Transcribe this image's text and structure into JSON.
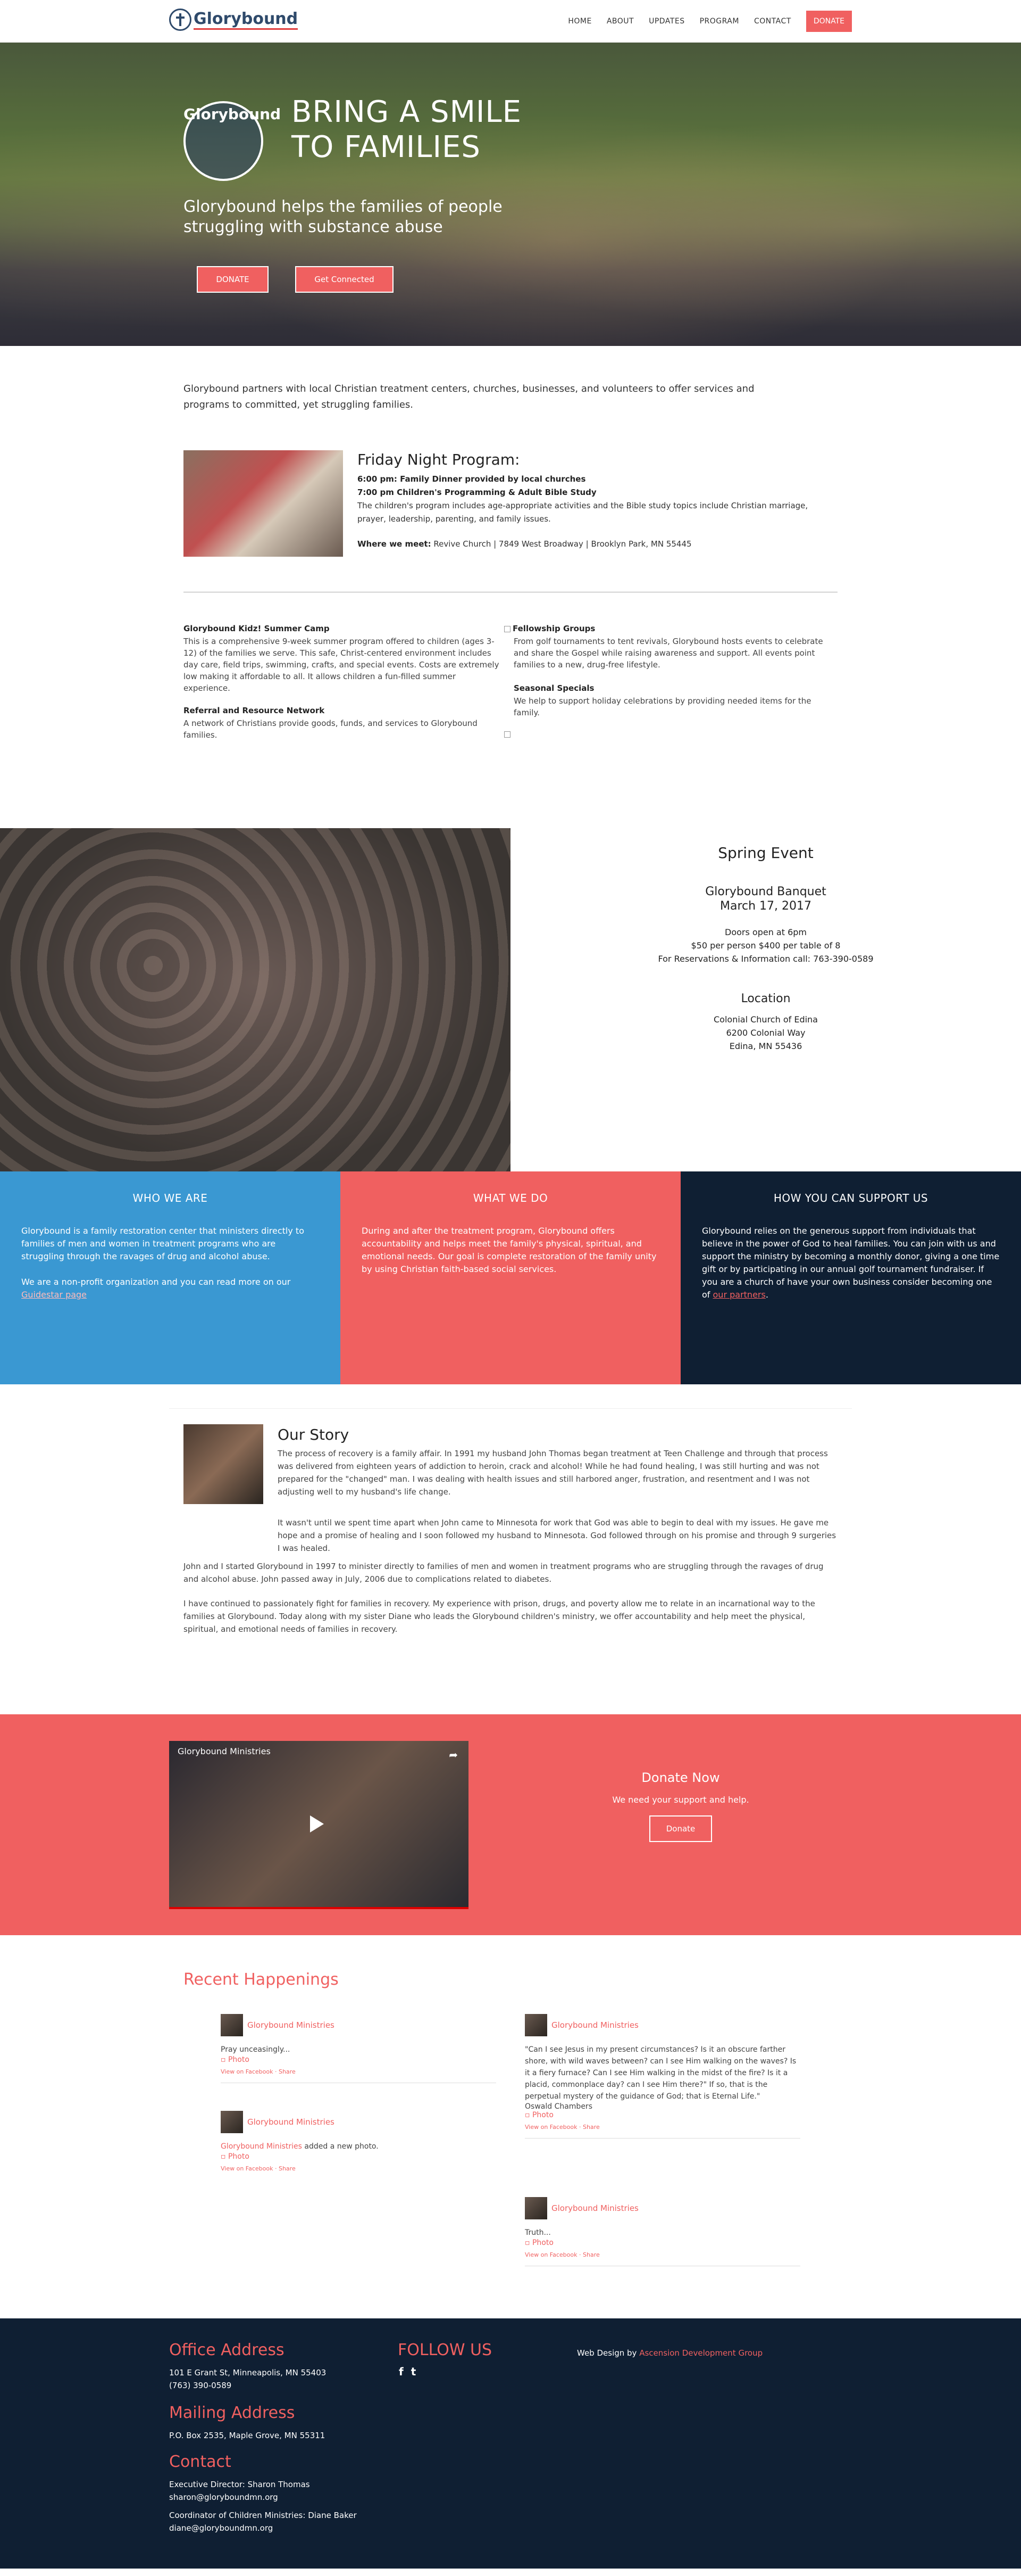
{
  "header": {
    "logo_text": "Glorybound",
    "nav": [
      "HOME",
      "ABOUT",
      "UPDATES",
      "PROGRAM",
      "CONTACT"
    ],
    "donate_label": "DONATE"
  },
  "hero": {
    "logo_text": "Glorybound",
    "title_line1": "BRING A SMILE",
    "title_line2": "TO FAMILIES",
    "subtitle": "Glorybound helps the families of people struggling with substance abuse",
    "donate_label": "DONATE",
    "connect_label": "Get Connected"
  },
  "intro": {
    "text": "Glorybound partners with local Christian treatment centers, churches, businesses, and volunteers to offer services and programs to committed, yet struggling families."
  },
  "program": {
    "title": "Friday Night Program:",
    "line1": "6:00 pm: Family Dinner provided by local churches",
    "line2": "7:00 pm Children's Programming & Adult Bible Study",
    "desc": "The children's program includes age-appropriate activities and the Bible study topics include Christian marriage, prayer, leadership, parenting, and family issues.",
    "where_label": "Where we meet:",
    "where_value": " Revive Church | 7849 West Broadway | Brooklyn Park, MN 55445"
  },
  "services": {
    "camp_title": "Glorybound Kidz! Summer Camp",
    "camp_text": "This is a comprehensive 9-week summer program offered to children (ages 3-12) of the families we serve. This safe, Christ-centered environment includes day care, field trips, swimming, crafts, and special events. Costs are extremely low making it affordable to all. It allows children a fun-filled summer experience.",
    "referral_title": "Referral and Resource Network",
    "referral_text": "A network of Christians provide goods, funds, and services to Glorybound families.",
    "fellowship_title": "Fellowship Groups",
    "fellowship_text": "From golf tournaments to tent revivals, Glorybound hosts events to celebrate and share the Gospel while raising awareness and support. All events point families to a new, drug-free lifestyle.",
    "seasonal_title": "Seasonal Specials",
    "seasonal_text": "We help to support holiday celebrations by providing needed items for the family."
  },
  "spring": {
    "title": "Spring Event",
    "event_name": "Glorybound Banquet",
    "date": "March 17, 2017",
    "doors": "Doors open at 6pm",
    "price": "$50 per person $400 per table of 8",
    "reservations": "For Reservations & Information call: 763-390-0589",
    "location_title": "Location",
    "loc1": "Colonial Church of Edina",
    "loc2": "6200 Colonial Way",
    "loc3": "Edina, MN 55436"
  },
  "boxes": {
    "who_title": "WHO WE ARE",
    "who_text": "Glorybound is a family restoration center that ministers directly to families of men and women in treatment programs who are struggling through the ravages of drug and alcohol abuse.",
    "who_text2": "We are a non-profit organization and you can read more on our ",
    "who_link": "Guidestar page",
    "what_title": "WHAT WE DO",
    "what_text": "During and after the treatment program, Glorybound offers accountability and helps meet the family's physical, spiritual, and emotional needs. Our goal is complete restoration of the family unity by using Christian faith-based social services.",
    "how_title": "HOW YOU CAN SUPPORT US",
    "how_text": "Glorybound relies on the generous support from individuals that believe in the power of God to heal families. You can join with us and support the ministry by becoming a monthly donor, giving a one time gift or by participating in our annual golf tournament fundraiser. If you are a church of have your own business consider becoming one of ",
    "how_link": "our partners",
    "how_end": "."
  },
  "story": {
    "title": "Our Story",
    "p1": "The process of recovery is a family affair. In 1991 my husband John Thomas began treatment at Teen Challenge and through that process was delivered from eighteen years of addiction to heroin, crack and alcohol! While he had found healing, I was still hurting and was not prepared for the \"changed\" man. I was dealing with health issues and still harbored anger, frustration, and resentment and I was not adjusting well to my husband's life change.",
    "p2": "It wasn't until we spent time apart when John came to Minnesota for work that God was able to begin to deal with my issues. He gave me hope and a promise of healing and I soon followed my husband to Minnesota. God followed through on his promise and through 9 surgeries I was healed.",
    "p3": "John and I started Glorybound in 1997 to minister directly to families of men and women in treatment programs who are struggling through the ravages of drug and alcohol abuse. John passed away in July, 2006 due to complications related to diabetes.",
    "p4": "I have continued to passionately fight for families in recovery. My experience with prison, drugs, and poverty allow me to relate in an incarnational way to the families at Glorybound. Today along with my sister Diane who leads the Glorybound children's ministry, we offer accountability and help meet the physical, spiritual, and emotional needs of families in recovery."
  },
  "donate_band": {
    "video_title": "Glorybound Ministries",
    "heading": "Donate Now",
    "text": "We need your support and help.",
    "button": "Donate"
  },
  "recent": {
    "title": "Recent Happenings",
    "posts": [
      {
        "author": "Glorybound Ministries",
        "text": "Pray unceasingly...",
        "photo": "Photo",
        "meta": "View on Facebook · Share"
      },
      {
        "author": "Glorybound Ministries",
        "text_link": "Glorybound Ministries",
        "text": " added a new photo.",
        "photo": "Photo",
        "meta": "View on Facebook · Share"
      },
      {
        "author": "Glorybound Ministries",
        "text": "\"Can I see Jesus in my present circumstances? Is it an obscure farther shore, with wild waves between? can I see Him walking on the waves? Is it a fiery furnace? Can I see Him walking in the midst of the fire? Is it a placid, commonplace day? can I see Him there?\" If so, that is the perpetual mystery of the guidance of God; that is Eternal Life.\"",
        "text2": "Oswald Chambers",
        "photo": "Photo",
        "meta": "View on Facebook · Share"
      },
      {
        "author": "Glorybound Ministries",
        "text": "Truth...",
        "photo": "Photo",
        "meta": "View on Facebook · Share"
      }
    ]
  },
  "footer": {
    "office_title": "Office Address",
    "office_line1": "101 E Grant St, Minneapolis, MN 55403",
    "office_line2": "(763) 390-0589",
    "mailing_title": "Mailing Address",
    "mailing_line": "P.O. Box 2535, Maple Grove, MN 55311",
    "contact_title": "Contact",
    "contact1": "Executive Director: Sharon Thomas",
    "contact2": "sharon@gloryboundmn.org",
    "contact3": "Coordinator of Children Ministries: Diane Baker",
    "contact4": "diane@gloryboundmn.org",
    "follow_title": "FOLLOW US",
    "facebook_icon": "f",
    "twitter_icon": "t",
    "credit_prefix": "Web Design by ",
    "credit_link": "Ascension Development Group"
  }
}
